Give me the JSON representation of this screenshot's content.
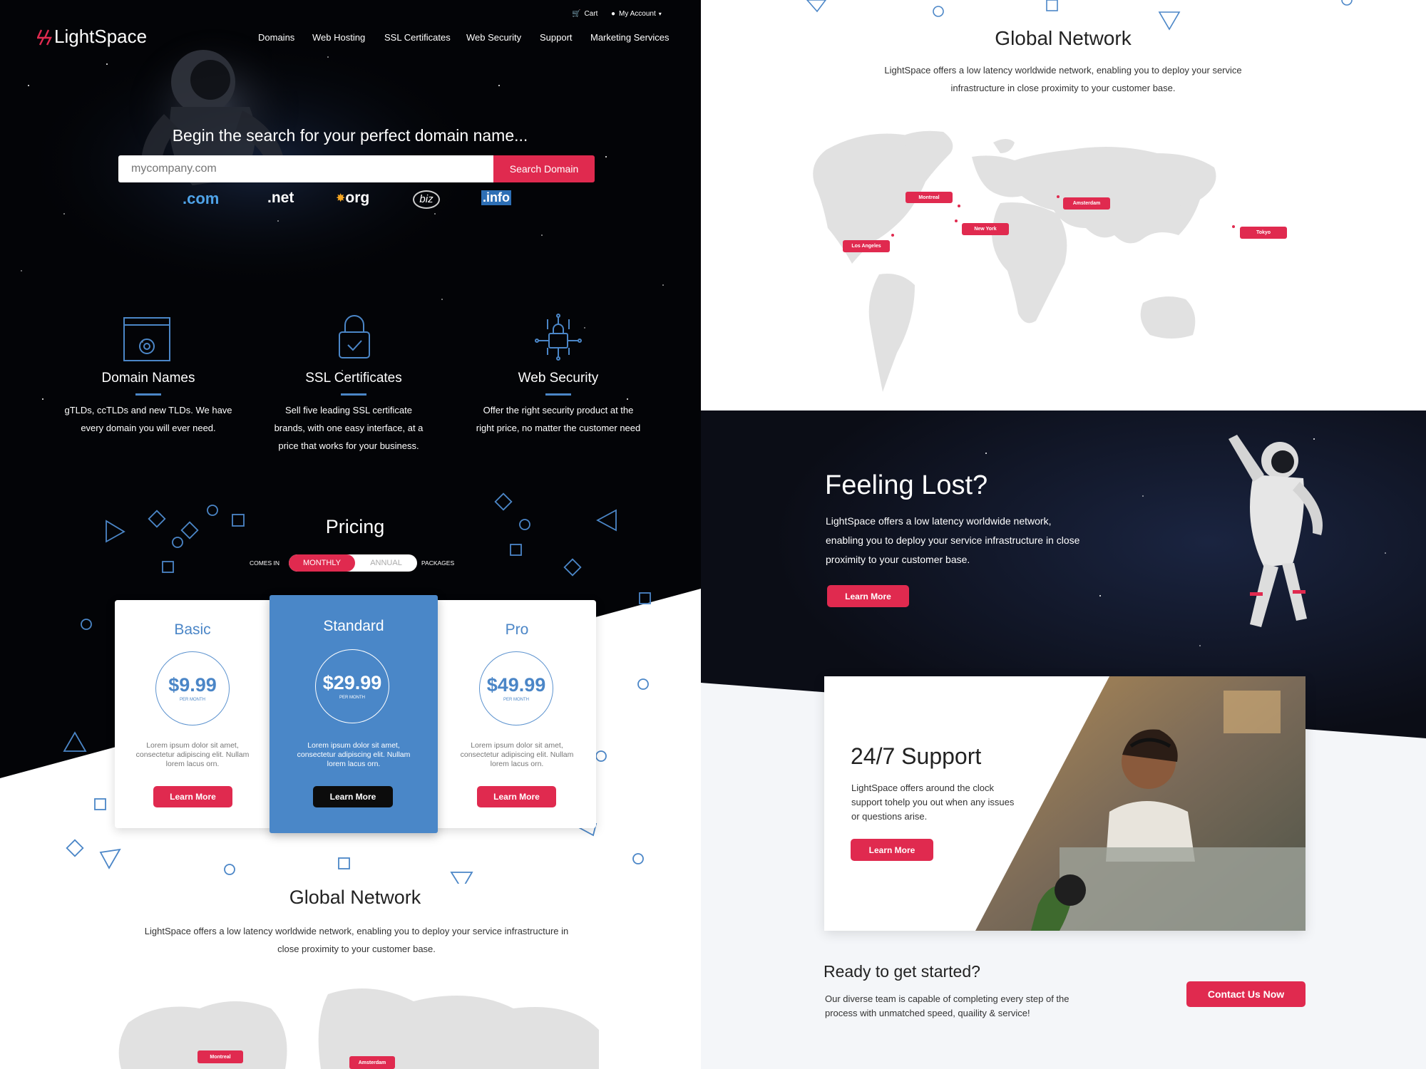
{
  "header": {
    "brand": "LightSpace",
    "cart_label": "Cart",
    "account_label": "My Account",
    "nav": [
      "Domains",
      "Web Hosting",
      "SSL Certificates",
      "Web Security",
      "Support",
      "Marketing Services"
    ]
  },
  "hero": {
    "heading": "Begin the search for your perfect domain name...",
    "search_placeholder": "mycompany.com",
    "search_button": "Search Domain",
    "tlds": [
      ".com",
      ".net",
      "org",
      "biz",
      ".info"
    ]
  },
  "features": [
    {
      "title": "Domain Names",
      "text": "gTLDs, ccTLDs and new TLDs. We have every domain you will ever need.",
      "icon": "browser-gear-icon"
    },
    {
      "title": "SSL Certificates",
      "text": "Sell five leading SSL certificate brands, with one easy interface, at a price that works for your business.",
      "icon": "padlock-icon"
    },
    {
      "title": "Web Security",
      "text": "Offer the right security product at the right price, no matter the customer need",
      "icon": "circuit-lock-icon"
    }
  ],
  "pricing": {
    "title": "Pricing",
    "comes_in": "COMES IN",
    "monthly": "MONTHLY",
    "annual": "ANNUAL",
    "packages": "PACKAGES",
    "plans": [
      {
        "name": "Basic",
        "price": "$9.99",
        "per": "PER MONTH",
        "text": "Lorem ipsum dolor sit amet, consectetur adipiscing elit. Nullam lorem lacus orn.",
        "button": "Learn More"
      },
      {
        "name": "Standard",
        "price": "$29.99",
        "per": "PER MONTH",
        "text": "Lorem ipsum dolor sit amet, consectetur adipiscing elit. Nullam lorem lacus orn.",
        "button": "Learn More"
      },
      {
        "name": "Pro",
        "price": "$49.99",
        "per": "PER MONTH",
        "text": "Lorem ipsum dolor sit amet, consectetur adipiscing elit. Nullam lorem lacus orn.",
        "button": "Learn More"
      }
    ]
  },
  "global_left": {
    "title": "Global Network",
    "text": "LightSpace offers a low latency worldwide network, enabling you to deploy your service infrastructure in close proximity to your customer base.",
    "pins": [
      "Montreal",
      "Amsterdam"
    ]
  },
  "global_right": {
    "title": "Global Network",
    "text": "LightSpace offers a low latency worldwide network, enabling you to deploy your service infrastructure in close proximity to your customer base.",
    "pins": [
      "Montreal",
      "Amsterdam",
      "New York",
      "Los Angeles",
      "Tokyo"
    ]
  },
  "lost": {
    "title": "Feeling Lost?",
    "text": "LightSpace offers a low latency worldwide network, enabling you to deploy your service infrastructure in close proximity to your customer base.",
    "button": "Learn More"
  },
  "support": {
    "title": "24/7 Support",
    "text": "LightSpace offers around the clock support tohelp you out when any issues or questions arise.",
    "button": "Learn More"
  },
  "cta": {
    "title": "Ready to get started?",
    "text": "Our diverse team is capable of completing every step of the process with unmatched speed, quaility & service!",
    "button": "Contact Us Now"
  },
  "colors": {
    "accent": "#e02a4f",
    "blue": "#4b86c7",
    "dark": "#030407",
    "map": "#e1e1e1"
  }
}
